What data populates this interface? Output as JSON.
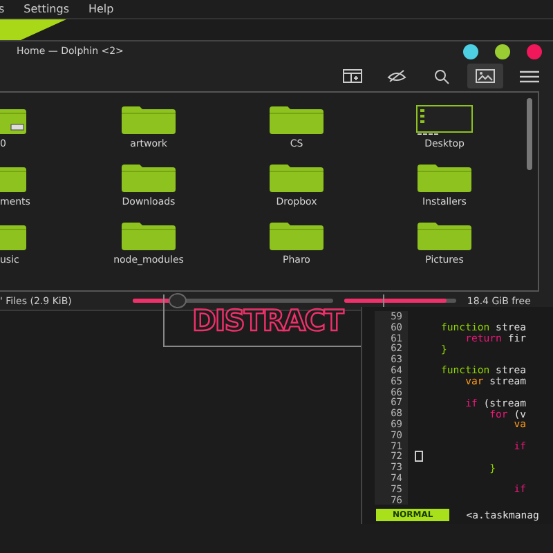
{
  "menu_bar": [
    "s",
    "Settings",
    "Help"
  ],
  "window": {
    "title": "Home — Dolphin <2>",
    "dots": [
      {
        "color": "#4dd0e1"
      },
      {
        "color": "#9acd32"
      },
      {
        "color": "#f0185a"
      }
    ]
  },
  "toolbar": [
    {
      "kind": "split",
      "selected": false
    },
    {
      "kind": "hidden",
      "selected": false
    },
    {
      "kind": "search",
      "selected": false
    },
    {
      "kind": "preview",
      "selected": true
    },
    {
      "kind": "menu",
      "selected": false
    }
  ],
  "files": [
    {
      "name": "0",
      "kind": "device"
    },
    {
      "name": "artwork",
      "kind": "folder"
    },
    {
      "name": "CS",
      "kind": "folder"
    },
    {
      "name": "Desktop",
      "kind": "desktop"
    },
    {
      "name": "ments",
      "kind": "folder"
    },
    {
      "name": "Downloads",
      "kind": "folder"
    },
    {
      "name": "Dropbox",
      "kind": "folder"
    },
    {
      "name": "Installers",
      "kind": "folder"
    },
    {
      "name": "usic",
      "kind": "folder"
    },
    {
      "name": "node_modules",
      "kind": "folder"
    },
    {
      "name": "Pharo",
      "kind": "folder"
    },
    {
      "name": "Pictures",
      "kind": "folder"
    }
  ],
  "status_bar": {
    "summary": "' Files (2.9 KiB)",
    "zoom": {
      "level": 0.22
    },
    "space": {
      "level": 0.92
    },
    "free": "18.4 GiB free"
  },
  "poster": {
    "text": "DISTRACT"
  },
  "editor": {
    "lines": [
      {
        "number": "59"
      },
      {
        "number": "60",
        "tokens": [
          {
            "kind": "keyword",
            "text": "function"
          },
          {
            "kind": "plain",
            "text": " strea"
          }
        ]
      },
      {
        "number": "61",
        "tokens": [
          {
            "kind": "control",
            "text": "    return"
          },
          {
            "kind": "plain",
            "text": " fir"
          }
        ]
      },
      {
        "number": "62",
        "tokens": [
          {
            "kind": "keyword",
            "text": "}"
          }
        ]
      },
      {
        "number": "63"
      },
      {
        "number": "64",
        "tokens": [
          {
            "kind": "keyword",
            "text": "function"
          },
          {
            "kind": "plain",
            "text": " strea"
          }
        ]
      },
      {
        "number": "65",
        "tokens": [
          {
            "kind": "storage",
            "text": "    var"
          },
          {
            "kind": "plain",
            "text": " stream"
          }
        ]
      },
      {
        "number": "66"
      },
      {
        "number": "67",
        "tokens": [
          {
            "kind": "control",
            "text": "    if"
          },
          {
            "kind": "plain",
            "text": " (stream"
          }
        ]
      },
      {
        "number": "68",
        "tokens": [
          {
            "kind": "control",
            "text": "        for"
          },
          {
            "kind": "plain",
            "text": " (v"
          }
        ]
      },
      {
        "number": "69",
        "tokens": [
          {
            "kind": "storage",
            "text": "            va"
          }
        ]
      },
      {
        "number": "70"
      },
      {
        "number": "71",
        "tokens": [
          {
            "kind": "control",
            "text": "            if"
          }
        ]
      },
      {
        "number": "72"
      },
      {
        "number": "73",
        "tokens": [
          {
            "kind": "keyword",
            "text": "        }"
          }
        ]
      },
      {
        "number": "74"
      },
      {
        "number": "75",
        "tokens": [
          {
            "kind": "control",
            "text": "            if"
          }
        ]
      },
      {
        "number": "76"
      }
    ],
    "mode": "NORMAL",
    "file": "<a.taskmanag"
  }
}
